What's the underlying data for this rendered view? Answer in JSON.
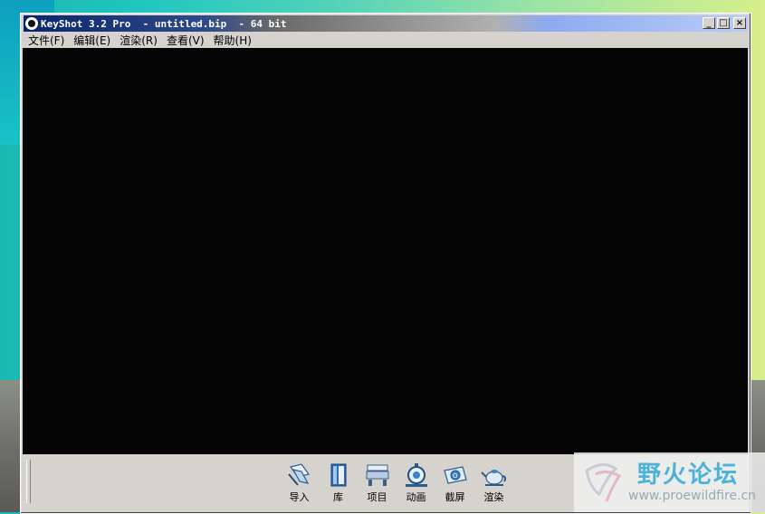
{
  "window": {
    "title": "KeyShot 3.2 Pro  - untitled.bip  - 64 bit",
    "controls": {
      "minimize": "_",
      "maximize": "□",
      "close": "×"
    }
  },
  "menu": [
    {
      "label": "文件(F)"
    },
    {
      "label": "编辑(E)"
    },
    {
      "label": "渲染(R)"
    },
    {
      "label": "查看(V)"
    },
    {
      "label": "帮助(H)"
    }
  ],
  "toolbar": [
    {
      "label": "导入",
      "icon": "import-icon"
    },
    {
      "label": "库",
      "icon": "library-icon"
    },
    {
      "label": "项目",
      "icon": "project-icon"
    },
    {
      "label": "动画",
      "icon": "animation-icon"
    },
    {
      "label": "截屏",
      "icon": "screenshot-icon"
    },
    {
      "label": "渲染",
      "icon": "render-teapot-icon"
    }
  ],
  "watermark": {
    "title": "野火论坛",
    "url": "www.proewildfire.cn"
  },
  "colors": {
    "titlebar_active": "#0a246a",
    "viewport": "#050405",
    "panel": "#d6d3ce"
  }
}
